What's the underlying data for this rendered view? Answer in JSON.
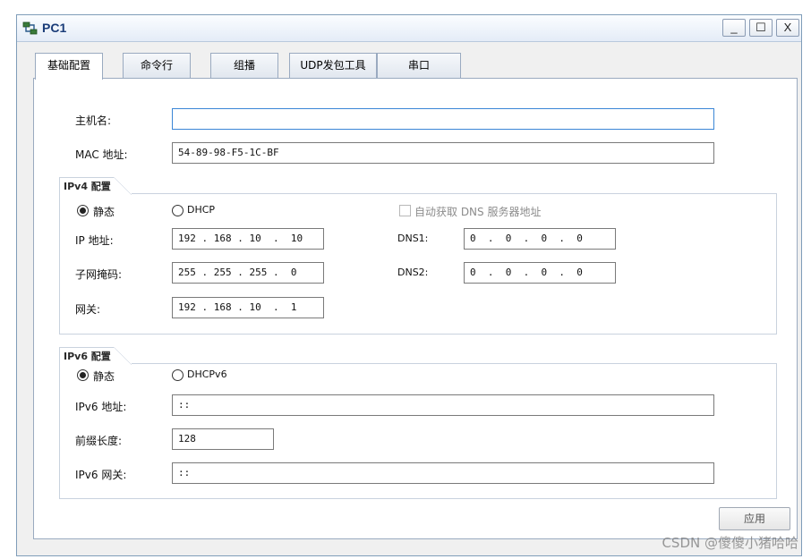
{
  "window": {
    "title": "PC1",
    "controls": {
      "minimize": "_",
      "maximize": "☐",
      "close": "X"
    }
  },
  "tabs": [
    {
      "label": "基础配置",
      "active": true
    },
    {
      "label": "命令行",
      "active": false
    },
    {
      "label": "组播",
      "active": false
    },
    {
      "label": "UDP发包工具",
      "active": false
    },
    {
      "label": "串口",
      "active": false
    }
  ],
  "basic": {
    "hostname_label": "主机名:",
    "hostname_value": "",
    "mac_label": "MAC 地址:",
    "mac_value": "54-89-98-F5-1C-BF"
  },
  "ipv4": {
    "group_title": "IPv4 配置",
    "static_label": "静态",
    "dhcp_label": "DHCP",
    "auto_dns_label": "自动获取 DNS 服务器地址",
    "ip_label": "IP 地址:",
    "ip_value": "192 . 168 . 10  .  10",
    "mask_label": "子网掩码:",
    "mask_value": "255 . 255 . 255 .  0",
    "gateway_label": "网关:",
    "gateway_value": "192 . 168 . 10  .  1",
    "dns1_label": "DNS1:",
    "dns1_value": "0  .  0  .  0  .  0",
    "dns2_label": "DNS2:",
    "dns2_value": "0  .  0  .  0  .  0"
  },
  "ipv6": {
    "group_title": "IPv6 配置",
    "static_label": "静态",
    "dhcp_label": "DHCPv6",
    "address_label": "IPv6 地址:",
    "address_value": "::",
    "prefix_label": "前缀长度:",
    "prefix_value": "128",
    "gateway_label": "IPv6 网关:",
    "gateway_value": "::"
  },
  "apply_button": "应用",
  "watermark": "CSDN @傻傻小猪哈哈"
}
